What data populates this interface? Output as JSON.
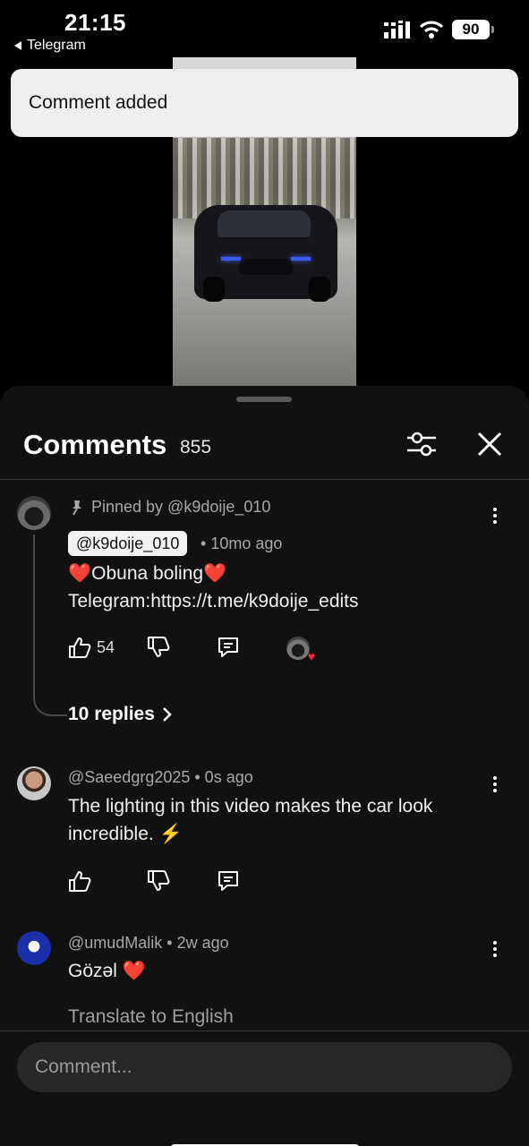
{
  "status_bar": {
    "time": "21:15",
    "back_app": "Telegram",
    "battery": "90"
  },
  "toast": {
    "text": "Comment added"
  },
  "sheet": {
    "title": "Comments",
    "count": "855"
  },
  "comments": [
    {
      "pinned_text": "Pinned by @k9doije_010",
      "author": "@k9doije_010",
      "time": "• 10mo ago",
      "line1": "❤️Obuna boling❤️",
      "line2": "Telegram:https://t.me/k9doije_edits",
      "likes": "54",
      "replies_label": "10 replies"
    },
    {
      "author_time": "@Saeedgrg2025 • 0s ago",
      "line1": "The lighting in this video makes the car look",
      "line2": "incredible. ⚡"
    },
    {
      "author_time": "@umudMalik • 2w ago",
      "line1": "Gözəl ❤️",
      "translate": "Translate to English"
    }
  ],
  "composer": {
    "placeholder": "Comment..."
  }
}
